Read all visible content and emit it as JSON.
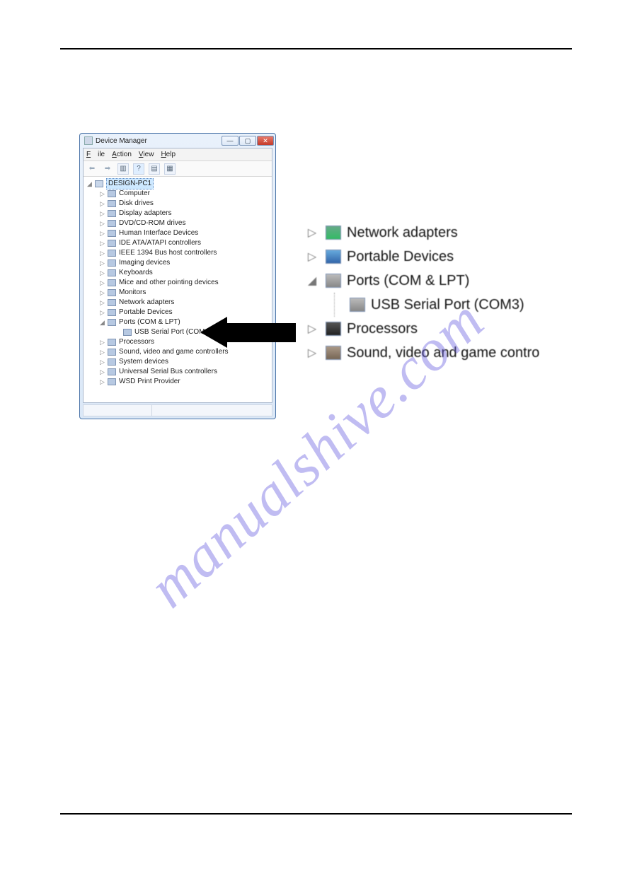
{
  "watermark": "manualshive.com",
  "window": {
    "title": "Device Manager",
    "menus": {
      "file": "File",
      "action": "Action",
      "view": "View",
      "help": "Help"
    },
    "buttons": {
      "min": "—",
      "max": "▢",
      "close": "✕"
    },
    "toolbar": {
      "back": "⬅",
      "fwd": "➡",
      "list": "▥",
      "help": "?",
      "props": "▤",
      "scan": "▦"
    }
  },
  "tree": {
    "root": "DESIGN-PC1",
    "items": [
      "Computer",
      "Disk drives",
      "Display adapters",
      "DVD/CD-ROM drives",
      "Human Interface Devices",
      "IDE ATA/ATAPI controllers",
      "IEEE 1394 Bus host controllers",
      "Imaging devices",
      "Keyboards",
      "Mice and other pointing devices",
      "Monitors",
      "Network adapters",
      "Portable Devices",
      "Ports (COM & LPT)",
      "Processors",
      "Sound, video and game controllers",
      "System devices",
      "Universal Serial Bus controllers",
      "WSD Print Provider"
    ],
    "ports_child": "USB Serial Port (COM3)"
  },
  "zoom": {
    "net": "Network adapters",
    "pd": "Portable Devices",
    "ports": "Ports (COM & LPT)",
    "usb": "USB Serial Port (COM3)",
    "proc": "Processors",
    "snd": "Sound, video and game contro"
  }
}
